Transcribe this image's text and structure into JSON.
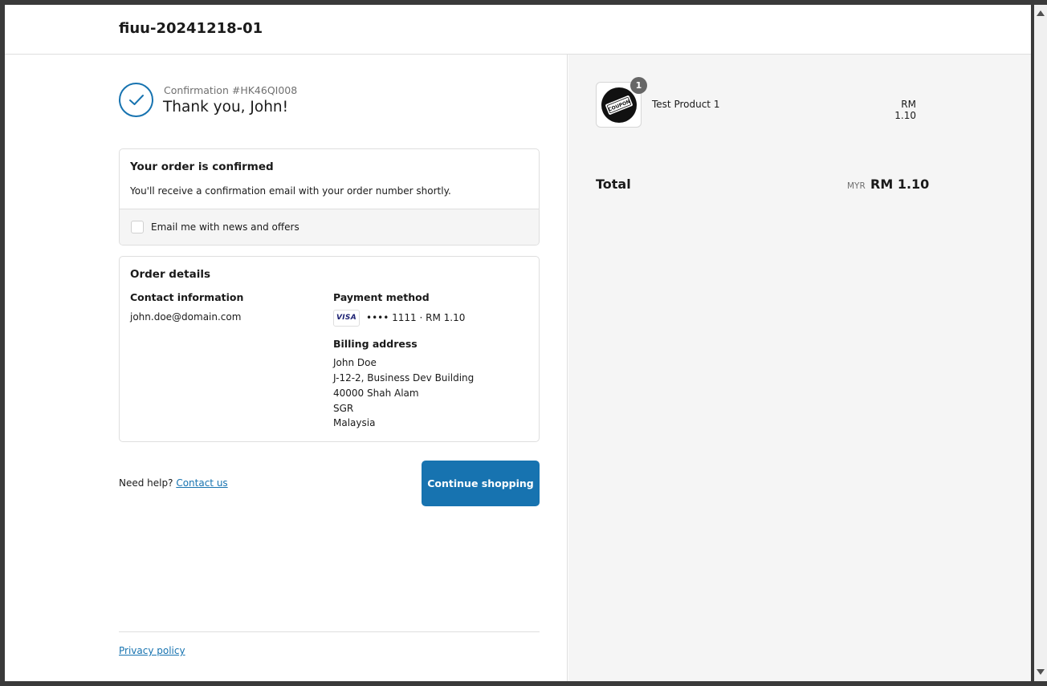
{
  "header": {
    "shop_title": "fiuu-20241218-01"
  },
  "confirmation": {
    "number_label": "Confirmation #HK46QI008",
    "thanks": "Thank you, John!"
  },
  "order_confirmed": {
    "title": "Your order is confirmed",
    "message": "You'll receive a confirmation email with your order number shortly.",
    "email_opt_in_label": "Email me with news and offers",
    "email_opt_in_checked": false
  },
  "order_details": {
    "title": "Order details",
    "contact_title": "Contact information",
    "contact_email": "john.doe@domain.com",
    "payment_title": "Payment method",
    "card_brand": "VISA",
    "card_summary": "•••• 1111 · RM 1.10",
    "billing_title": "Billing address",
    "billing_lines": [
      "John Doe",
      "J-12-2, Business Dev Building",
      "40000 Shah Alam",
      "SGR",
      "Malaysia"
    ]
  },
  "actions": {
    "help_text": "Need help?",
    "contact_link": "Contact us",
    "continue_label": "Continue shopping"
  },
  "footer": {
    "privacy_link": "Privacy policy"
  },
  "summary": {
    "product_image_text": "COUPON",
    "product_name": "Test Product 1",
    "product_qty": "1",
    "product_price": "RM 1.10",
    "total_label": "Total",
    "currency": "MYR",
    "total_value": "RM 1.10"
  },
  "colors": {
    "accent": "#1773b0",
    "sidebar_bg": "#f5f5f5",
    "border": "#dedede"
  }
}
